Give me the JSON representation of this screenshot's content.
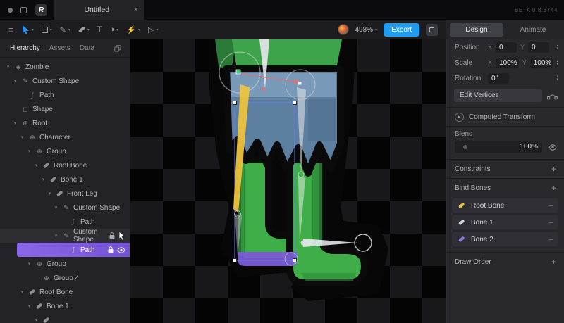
{
  "titlebar": {
    "logo_letter": "R",
    "tab_title": "Untitled",
    "beta_label": "BETA 0.8.3744"
  },
  "toolbar": {
    "zoom_value": "498%",
    "export_label": "Export"
  },
  "mode_tabs": [
    {
      "label": "Design",
      "active": true
    },
    {
      "label": "Animate",
      "active": false
    }
  ],
  "sidebar": {
    "tabs": [
      {
        "label": "Hierarchy",
        "active": true
      },
      {
        "label": "Assets",
        "active": false
      },
      {
        "label": "Data",
        "active": false
      }
    ],
    "tree": [
      {
        "label": "Zombie"
      },
      {
        "label": "Custom Shape"
      },
      {
        "label": "Path"
      },
      {
        "label": "Shape"
      },
      {
        "label": "Root"
      },
      {
        "label": "Character"
      },
      {
        "label": "Group"
      },
      {
        "label": "Root Bone"
      },
      {
        "label": "Bone 1"
      },
      {
        "label": "Front Leg"
      },
      {
        "label": "Custom Shape"
      },
      {
        "label": "Path"
      },
      {
        "label": "Custom Shape"
      },
      {
        "label": "Path"
      },
      {
        "label": "Group"
      },
      {
        "label": "Group 4"
      },
      {
        "label": "Root Bone"
      },
      {
        "label": "Bone 1"
      }
    ]
  },
  "inspector": {
    "position_label": "Position",
    "position_x_key": "X",
    "position_x": "0",
    "position_y_key": "Y",
    "position_y": "0",
    "scale_label": "Scale",
    "scale_x_key": "X",
    "scale_x": "100%",
    "scale_y_key": "Y",
    "scale_y": "100%",
    "rotation_label": "Rotation",
    "rotation_value": "0°",
    "edit_vertices_label": "Edit Vertices",
    "computed_transform_label": "Computed Transform",
    "blend_label": "Blend",
    "blend_value": "100%",
    "constraints_label": "Constraints",
    "bind_bones_label": "Bind Bones",
    "bind_bones": [
      {
        "name": "Root Bone",
        "color": "#edc23d"
      },
      {
        "name": "Bone 1",
        "color": "#ccd5e5"
      },
      {
        "name": "Bone 2",
        "color": "#8f7ae0"
      }
    ],
    "draw_order_label": "Draw Order"
  },
  "icons": {
    "close": "×",
    "menu": "≡",
    "caret_small": "▾",
    "caret_down": "▾",
    "caret_right": "▸",
    "artboard": "◈",
    "pen": "✎",
    "path": "∫",
    "shape": "◻",
    "group": "⊕",
    "text_tool": "T",
    "paint": "◑",
    "events": "⚡",
    "play": "▷",
    "plus": "+",
    "minus": "–",
    "step_up": "▴",
    "step_down": "▾"
  },
  "colors": {
    "accent_blue": "#1f9bf0",
    "selection_purple": "#7c5cd6",
    "bone_yellow": "#edc23d",
    "artwork_green": "#3fae49",
    "artwork_dark_green": "#2e8b3a",
    "artwork_blue": "#5d80a0",
    "outline_black": "#0a0a0a"
  }
}
